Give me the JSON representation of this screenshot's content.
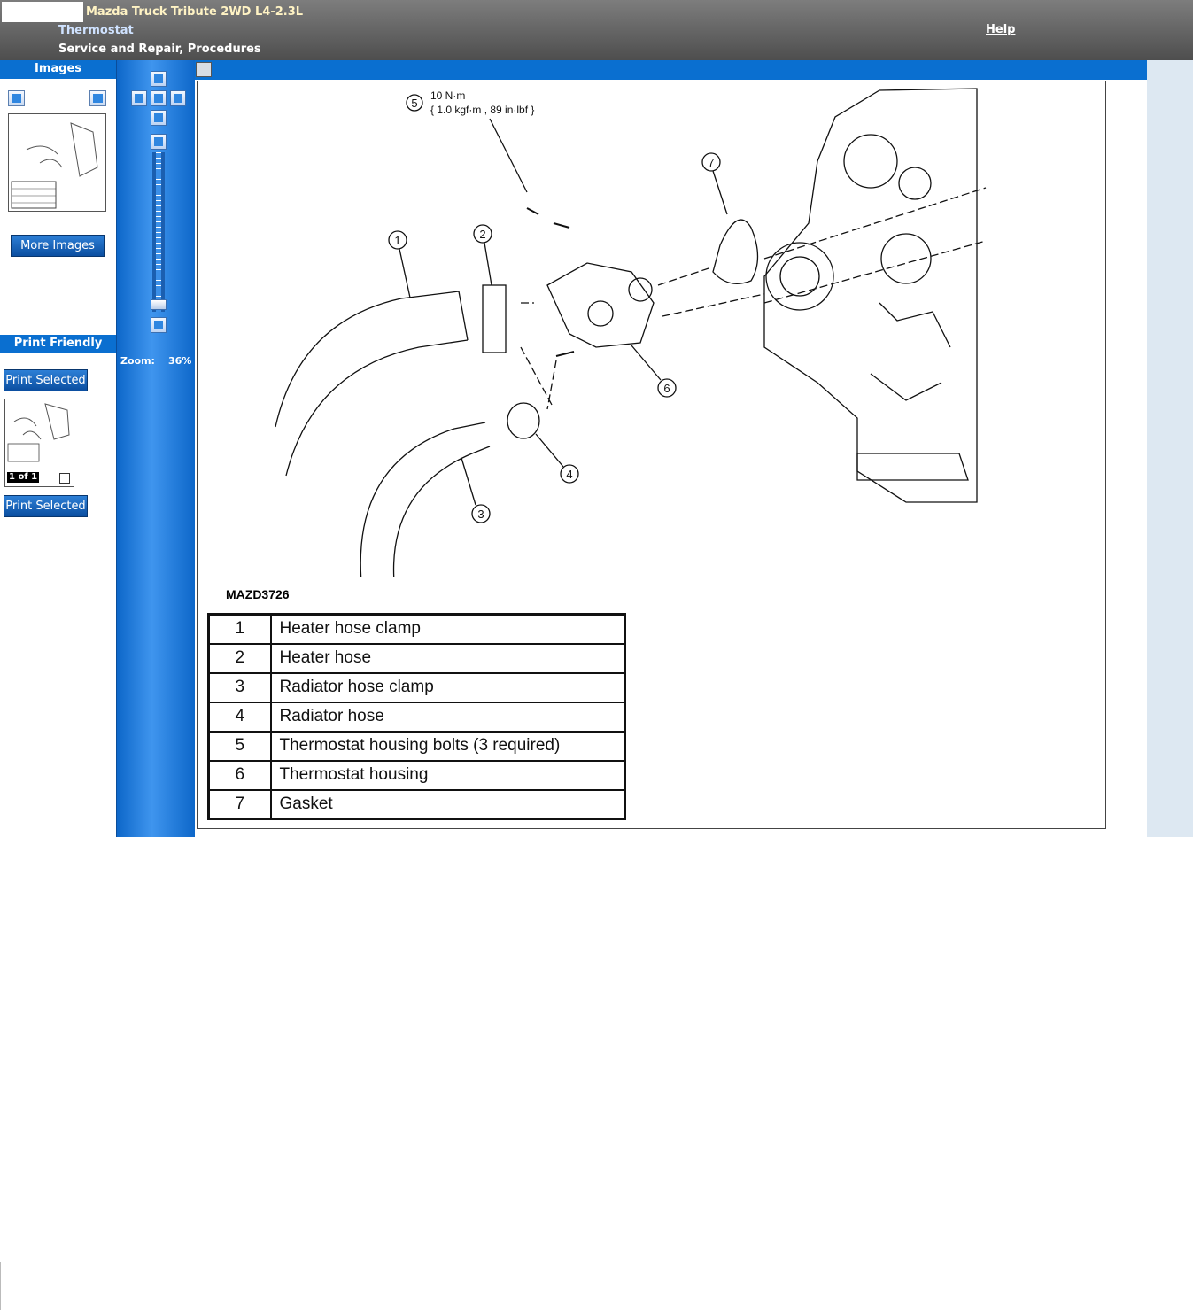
{
  "header": {
    "vehicle": "Mazda Truck Tribute 2WD L4-2.3L",
    "section": "Thermostat",
    "procedure": "Service and Repair, Procedures",
    "help": "Help"
  },
  "left_panel": {
    "images_heading": "Images",
    "more_images": "More Images",
    "print_heading": "Print Friendly",
    "print_selected": "Print Selected",
    "page_indicator": "1 of 1"
  },
  "zoom": {
    "label": "Zoom:",
    "value": "36%"
  },
  "diagram": {
    "torque_callout": "5",
    "torque_line1": "10 N·m",
    "torque_line2": "{ 1.0 kgf·m , 89 in·lbf }",
    "callouts": [
      "1",
      "2",
      "3",
      "4",
      "6",
      "7"
    ],
    "figure_code": "MAZD3726",
    "legend": [
      {
        "num": "1",
        "name": "Heater hose clamp"
      },
      {
        "num": "2",
        "name": "Heater hose"
      },
      {
        "num": "3",
        "name": "Radiator hose clamp"
      },
      {
        "num": "4",
        "name": "Radiator hose"
      },
      {
        "num": "5",
        "name": "Thermostat housing bolts (3 required)"
      },
      {
        "num": "6",
        "name": "Thermostat housing"
      },
      {
        "num": "7",
        "name": "Gasket"
      }
    ]
  },
  "icons": {
    "prev": "arrow-left-icon",
    "next": "arrow-right-icon",
    "pan": "pan-arrows-icon",
    "zoom_in": "plus-icon",
    "zoom_out": "minus-icon",
    "print": "printer-icon"
  }
}
